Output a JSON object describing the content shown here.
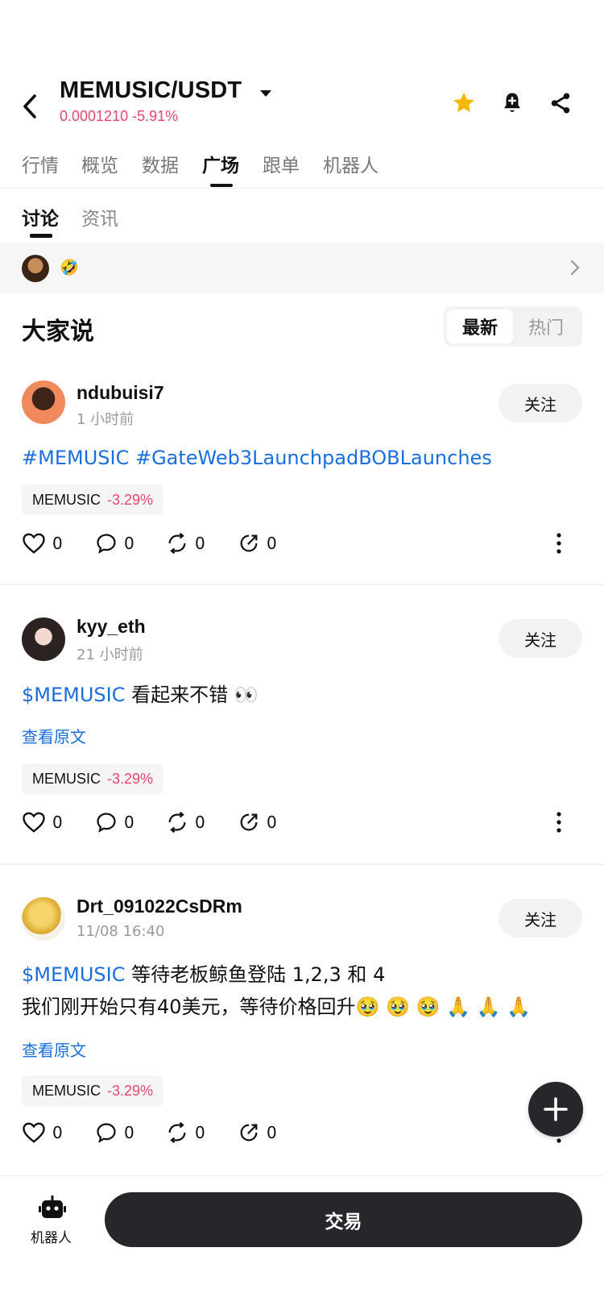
{
  "header": {
    "pair": "MEMUSIC/USDT",
    "price_line": "0.0001210 -5.91%",
    "colors": {
      "down": "#e5476d",
      "star": "#f5b700"
    }
  },
  "tabs": [
    "行情",
    "概览",
    "数据",
    "广场",
    "跟单",
    "机器人"
  ],
  "active_tab": "广场",
  "subtabs": [
    "讨论",
    "资讯"
  ],
  "active_subtab": "讨论",
  "hot_bar": {
    "emoji": "🤣"
  },
  "section": {
    "title": "大家说",
    "sort_latest": "最新",
    "sort_hot": "热门"
  },
  "posts": [
    {
      "username": "ndubuisi7",
      "time": "1 小时前",
      "follow": "关注",
      "content_link": "#MEMUSIC #GateWeb3LaunchpadBOBLaunches",
      "content_text": "",
      "content_line2": "",
      "view_raw": "",
      "coin": "MEMUSIC",
      "change": "-3.29%",
      "likes": "0",
      "comments": "0",
      "reposts": "0",
      "shares": "0"
    },
    {
      "username": "kyy_eth",
      "time": "21 小时前",
      "follow": "关注",
      "content_link": "$MEMUSIC",
      "content_text": " 看起来不错 👀",
      "content_line2": "",
      "view_raw": "查看原文",
      "coin": "MEMUSIC",
      "change": "-3.29%",
      "likes": "0",
      "comments": "0",
      "reposts": "0",
      "shares": "0"
    },
    {
      "username": "Drt_091022CsDRm",
      "time": "11/08 16:40",
      "follow": "关注",
      "content_link": "$MEMUSIC",
      "content_text": " 等待老板鲸鱼登陆 1,2,3 和 4",
      "content_line2": "我们刚开始只有40美元，等待价格回升🥹 🥹 🥹 🙏 🙏 🙏",
      "view_raw": "查看原文",
      "coin": "MEMUSIC",
      "change": "-3.29%",
      "likes": "0",
      "comments": "0",
      "reposts": "0",
      "shares": "0"
    }
  ],
  "bottom": {
    "bot_label": "机器人",
    "trade_label": "交易"
  },
  "icons": [
    "back-arrow-icon",
    "caret-down-icon",
    "star-icon",
    "bell-plus-icon",
    "share-icon",
    "chevron-right-icon",
    "heart-icon",
    "comment-icon",
    "repost-icon",
    "share-arrow-icon",
    "more-vertical-icon",
    "plus-icon",
    "robot-icon"
  ]
}
